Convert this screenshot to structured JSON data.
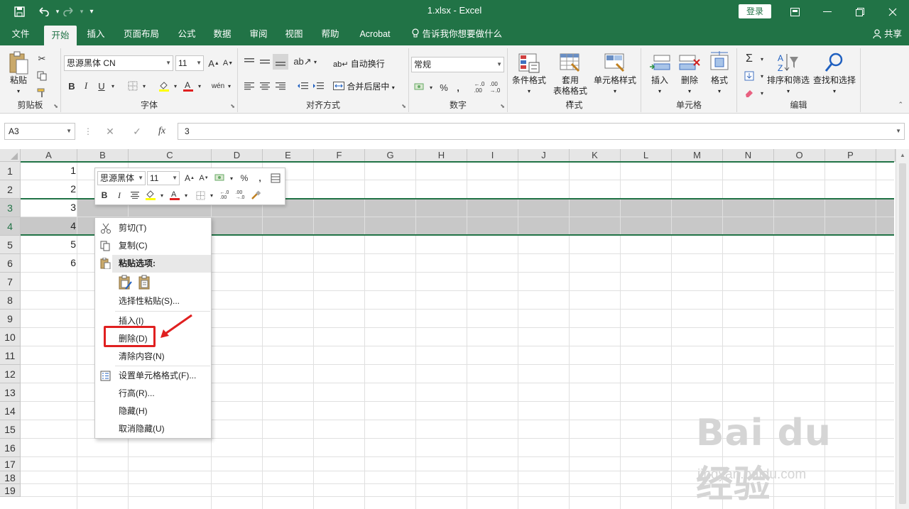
{
  "titlebar": {
    "title": "1.xlsx  -  Excel",
    "login": "登录",
    "qa_save_icon": "save-icon",
    "qa_undo_icon": "undo-icon",
    "qa_redo_icon": "redo-icon",
    "qa_customize_icon": "customize-icon"
  },
  "tabs": [
    "文件",
    "开始",
    "插入",
    "页面布局",
    "公式",
    "数据",
    "审阅",
    "视图",
    "帮助",
    "Acrobat"
  ],
  "tell_me": "告诉我你想要做什么",
  "share": "共享",
  "ribbon": {
    "clipboard": {
      "label": "剪贴板",
      "paste": "粘贴"
    },
    "font": {
      "label": "字体",
      "font_name": "思源黑体 CN",
      "font_size": "11"
    },
    "alignment": {
      "label": "对齐方式",
      "wrap": "自动换行",
      "merge": "合并后居中"
    },
    "number": {
      "label": "数字",
      "format": "常规"
    },
    "styles": {
      "label": "样式",
      "conditional": "条件格式",
      "table_l1": "套用",
      "table_l2": "表格格式",
      "cell_styles": "单元格样式"
    },
    "cells": {
      "label": "单元格",
      "insert": "插入",
      "delete": "删除",
      "format": "格式"
    },
    "editing": {
      "label": "编辑",
      "sort": "排序和筛选",
      "find": "查找和选择"
    }
  },
  "formula_bar": {
    "name_box": "A3",
    "fx": "fx",
    "value": "3"
  },
  "columns": [
    "A",
    "B",
    "C",
    "D",
    "E",
    "F",
    "G",
    "H",
    "I",
    "J",
    "K",
    "L",
    "M",
    "N",
    "O",
    "P"
  ],
  "rows": [
    "1",
    "2",
    "3",
    "4",
    "5",
    "6",
    "7",
    "8",
    "9",
    "10",
    "11",
    "12",
    "13",
    "14",
    "15",
    "16",
    "17",
    "18",
    "19"
  ],
  "cells_a": [
    "1",
    "2",
    "3",
    "4",
    "5",
    "6"
  ],
  "mini_toolbar": {
    "font_name": "思源黑体",
    "font_size": "11"
  },
  "context_menu": {
    "cut": "剪切(T)",
    "copy": "复制(C)",
    "paste_options": "粘贴选项:",
    "paste_special": "选择性粘贴(S)...",
    "insert": "插入(I)",
    "delete": "删除(D)",
    "clear": "清除内容(N)",
    "format_cells": "设置单元格格式(F)...",
    "row_height": "行高(R)...",
    "hide": "隐藏(H)",
    "unhide": "取消隐藏(U)"
  },
  "watermark": {
    "brand": "Bai du 经验",
    "url": "jingyan.baidu.com"
  },
  "colors": {
    "excel_green": "#217346",
    "highlight_red": "#e02020",
    "selection_gray": "#c8c8c8"
  }
}
